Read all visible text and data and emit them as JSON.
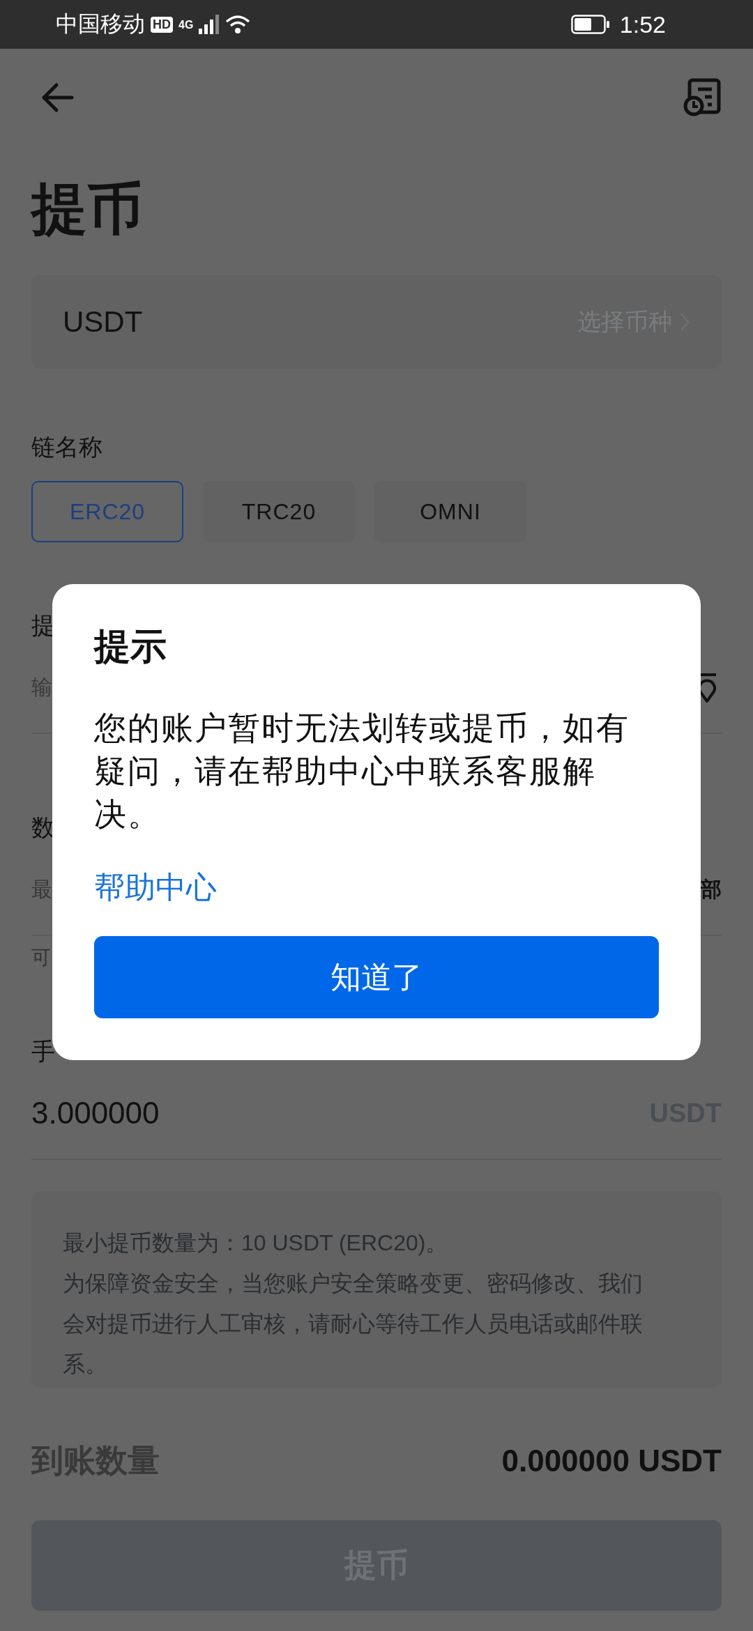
{
  "status_bar": {
    "carrier": "中国移动",
    "hd": "HD",
    "network": "4G",
    "time": "1:52"
  },
  "title": "提币",
  "coin": {
    "value": "USDT",
    "action": "选择币种"
  },
  "chain": {
    "label": "链名称",
    "options": [
      {
        "label": "ERC20",
        "selected": true
      },
      {
        "label": "TRC20",
        "selected": false
      },
      {
        "label": "OMNI",
        "selected": false
      }
    ]
  },
  "address_field": {
    "label": "提",
    "placeholder": "输"
  },
  "amount_field": {
    "label": "数",
    "placeholder": "最",
    "action": "部",
    "available": "可"
  },
  "fee": {
    "label": "手",
    "value": "3.000000",
    "unit": "USDT"
  },
  "notice": [
    "最小提币数量为：10 USDT (ERC20)。",
    "为保障资金安全，当您账户安全策略变更、密码修改、我们会对提币进行人工审核，请耐心等待工作人员电话或邮件联系。"
  ],
  "receive": {
    "label": "到账数量",
    "value": "0.000000 USDT"
  },
  "submit": {
    "label": "提币",
    "disabled": true
  },
  "dialog": {
    "title": "提示",
    "message": "您的账户暂时无法划转或提币，如有疑问，请在帮助中心中联系客服解决。",
    "link": "帮助中心",
    "button": "知道了"
  }
}
